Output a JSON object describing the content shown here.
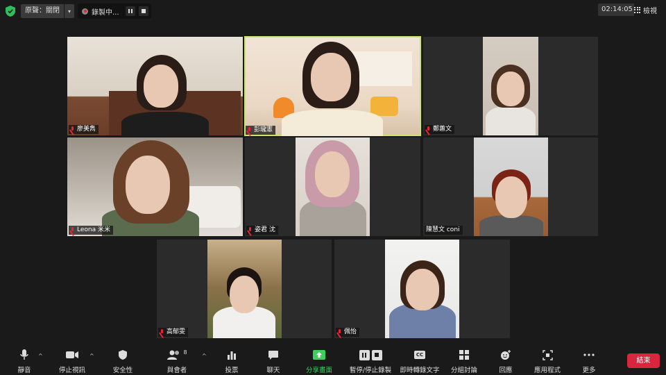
{
  "topbar": {
    "original_sound": "原聲：關閉",
    "recording": "錄製中...",
    "timer": "02:14:05",
    "view": "檢視"
  },
  "participants": [
    {
      "name": "廖美雋",
      "muted": true
    },
    {
      "name": "彭瓏憲",
      "muted": true,
      "active_speaker": true
    },
    {
      "name": "鄭蕙文",
      "muted": true
    },
    {
      "name": "Leona 米米",
      "muted": true
    },
    {
      "name": "姿君 沈",
      "muted": true
    },
    {
      "name": "陳慧文 coni",
      "muted": false
    },
    {
      "name": "高郁雯",
      "muted": true
    },
    {
      "name": "佩怡",
      "muted": true
    }
  ],
  "toolbar": {
    "mute": "靜音",
    "stop_video": "停止視訊",
    "security": "安全性",
    "participants": "與會者",
    "participants_count": "8",
    "polls": "投票",
    "chat": "聊天",
    "share_screen": "分享畫面",
    "pause_stop_recording": "暫停/停止錄製",
    "live_transcript": "即時轉錄文字",
    "cc": "CC",
    "breakout_rooms": "分組討論",
    "reactions": "回應",
    "apps": "應用程式",
    "more": "更多",
    "end": "結束"
  },
  "colors": {
    "background": "#1a1a1a",
    "tile": "#2b2b2b",
    "active_speaker_border": "#c9e46b",
    "share_green": "#3ecf5f",
    "end_red": "#d7263d",
    "mute_red": "#e22233"
  }
}
